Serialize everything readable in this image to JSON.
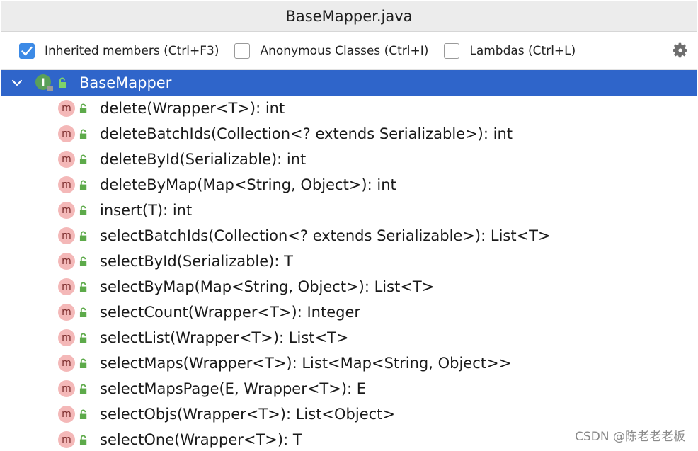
{
  "window": {
    "title": "BaseMapper.java"
  },
  "toolbar": {
    "inherited_label": "Inherited members (Ctrl+F3)",
    "inherited_checked": true,
    "anonymous_label": "Anonymous Classes (Ctrl+I)",
    "anonymous_checked": false,
    "lambdas_label": "Lambdas (Ctrl+L)",
    "lambdas_checked": false,
    "settings_icon": "gear-icon"
  },
  "tree": {
    "root": {
      "label": "BaseMapper",
      "icon": "interface-icon",
      "expanded": true,
      "selected": true
    },
    "method_badge": "m",
    "methods": [
      "delete(Wrapper<T>): int",
      "deleteBatchIds(Collection<? extends Serializable>): int",
      "deleteById(Serializable): int",
      "deleteByMap(Map<String, Object>): int",
      "insert(T): int",
      "selectBatchIds(Collection<? extends Serializable>): List<T>",
      "selectById(Serializable): T",
      "selectByMap(Map<String, Object>): List<T>",
      "selectCount(Wrapper<T>): Integer",
      "selectList(Wrapper<T>): List<T>",
      "selectMaps(Wrapper<T>): List<Map<String, Object>>",
      "selectMapsPage(E, Wrapper<T>): E",
      "selectObjs(Wrapper<T>): List<Object>",
      "selectOne(Wrapper<T>): T"
    ]
  },
  "watermark": "CSDN @陈老老老板",
  "colors": {
    "selection": "#2f65ca",
    "checkbox": "#3c8ae6",
    "method_badge": "#f4b8b8",
    "lock": "#5daa4a"
  }
}
